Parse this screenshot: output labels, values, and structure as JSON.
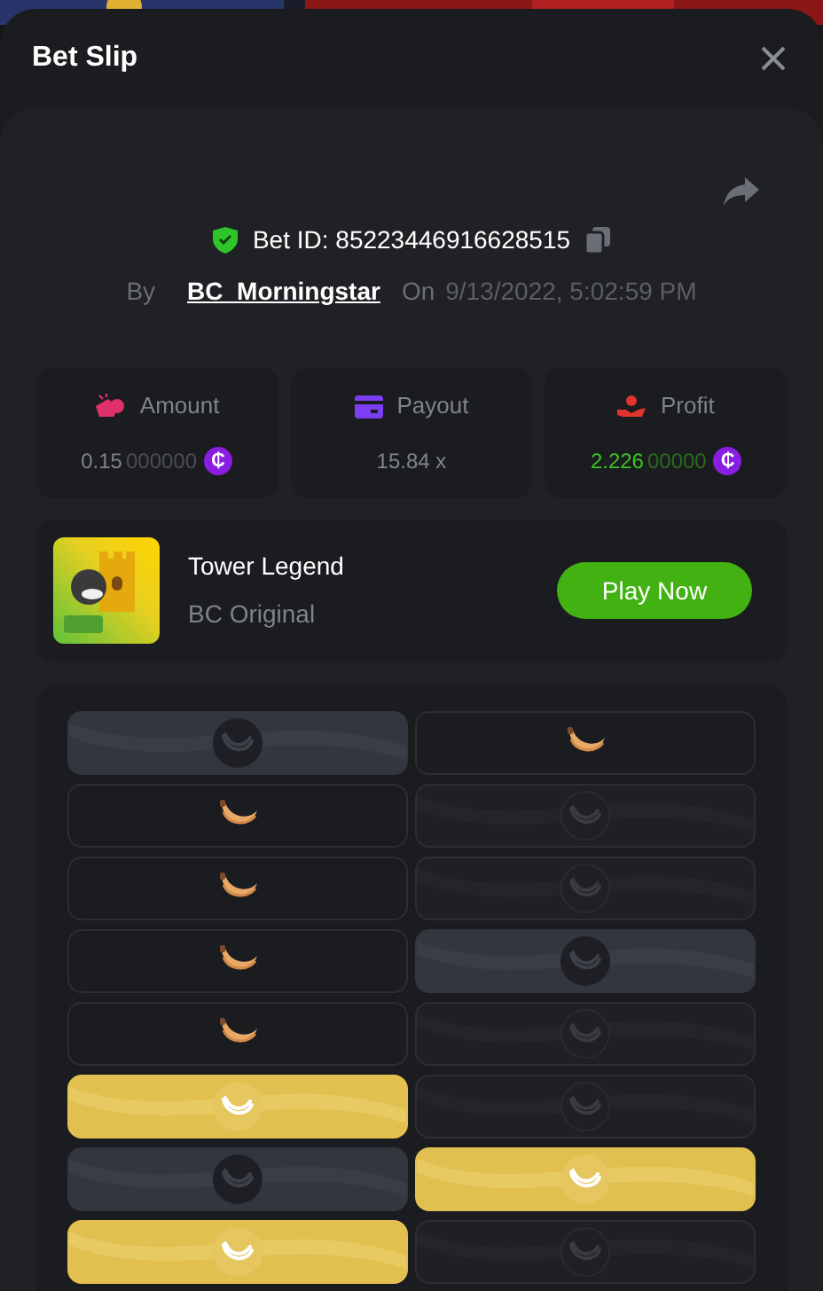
{
  "title": "Bet Slip",
  "bet": {
    "id_label": "Bet ID: 85223446916628515",
    "by_label": "By",
    "user": "BC_Morningstar",
    "on_label": "On",
    "date": "9/13/2022, 5:02:59 PM"
  },
  "stats": [
    {
      "kind": "amount",
      "label": "Amount",
      "value": "0.15",
      "trailing": "000000",
      "coin": "₵"
    },
    {
      "kind": "payout",
      "label": "Payout",
      "value": "15.84 x"
    },
    {
      "kind": "profit",
      "label": "Profit",
      "value": "2.226",
      "trailing": "00000",
      "coin": "₵"
    }
  ],
  "game": {
    "name": "Tower Legend",
    "provider": "BC Original",
    "button": "Play Now"
  },
  "tiles": [
    {
      "kind": "picked"
    },
    {
      "kind": "banana"
    },
    {
      "kind": "banana"
    },
    {
      "kind": "hidden"
    },
    {
      "kind": "banana"
    },
    {
      "kind": "hidden"
    },
    {
      "kind": "banana"
    },
    {
      "kind": "picked"
    },
    {
      "kind": "banana"
    },
    {
      "kind": "hidden"
    },
    {
      "kind": "gold"
    },
    {
      "kind": "hidden"
    },
    {
      "kind": "picked"
    },
    {
      "kind": "gold"
    },
    {
      "kind": "gold"
    },
    {
      "kind": "hidden"
    }
  ]
}
